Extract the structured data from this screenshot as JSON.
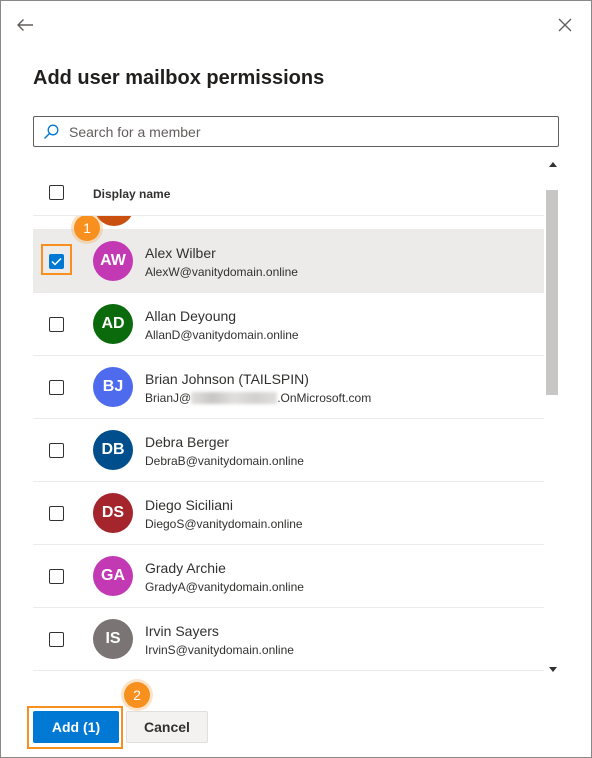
{
  "panel": {
    "title": "Add user mailbox permissions",
    "back_icon": "arrow-left-icon",
    "close_icon": "close-icon"
  },
  "search": {
    "placeholder": "Search for a member",
    "value": "",
    "icon": "search-icon"
  },
  "table": {
    "column_header": "Display name",
    "rows": [
      {
        "initials": "AW",
        "name": "Alex Wilber",
        "email": "AlexW@vanitydomain.online",
        "color": "#c239b3",
        "selected": true
      },
      {
        "initials": "AD",
        "name": "Allan Deyoung",
        "email": "AllanD@vanitydomain.online",
        "color": "#0b6a0b",
        "selected": false
      },
      {
        "initials": "BJ",
        "name": "Brian Johnson (TAILSPIN)",
        "email_prefix": "BrianJ@",
        "email_suffix": ".OnMicrosoft.com",
        "color": "#4f6bed",
        "selected": false
      },
      {
        "initials": "DB",
        "name": "Debra Berger",
        "email": "DebraB@vanitydomain.online",
        "color": "#004e8c",
        "selected": false
      },
      {
        "initials": "DS",
        "name": "Diego Siciliani",
        "email": "DiegoS@vanitydomain.online",
        "color": "#a4262c",
        "selected": false
      },
      {
        "initials": "GA",
        "name": "Grady Archie",
        "email": "GradyA@vanitydomain.online",
        "color": "#c239b3",
        "selected": false
      },
      {
        "initials": "IS",
        "name": "Irvin Sayers",
        "email": "IrvinS@vanitydomain.online",
        "color": "#7a7574",
        "selected": false
      }
    ]
  },
  "callouts": {
    "step1": "1",
    "step2": "2"
  },
  "footer": {
    "add_label": "Add (1)",
    "cancel_label": "Cancel"
  },
  "colors": {
    "accent": "#0078d4",
    "callout": "#f7901e"
  }
}
